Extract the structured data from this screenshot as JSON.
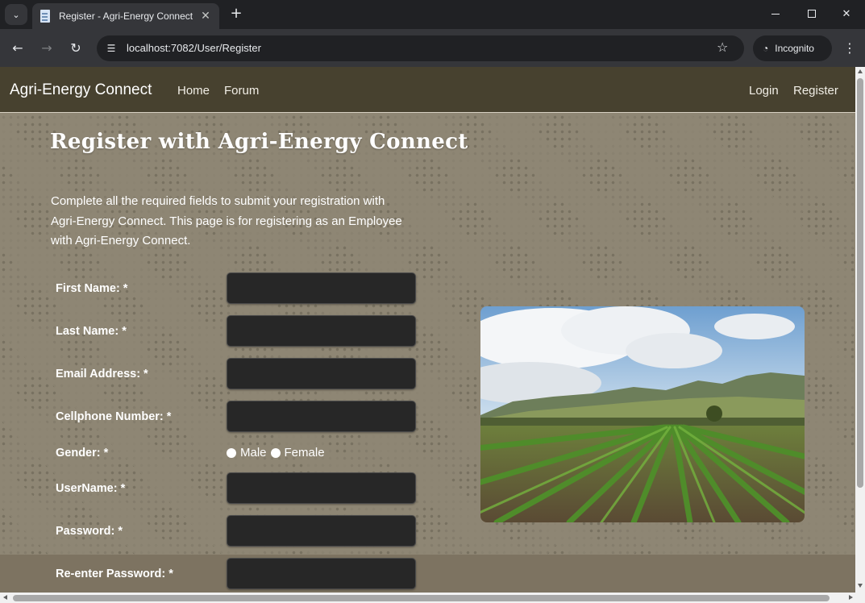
{
  "browser": {
    "tab_title": "Register - Agri-Energy Connect",
    "url": "localhost:7082/User/Register",
    "incognito_label": "Incognito",
    "icons": [
      "tab-search-icon",
      "favicon-icon",
      "close-icon",
      "plus-icon",
      "minimize-icon",
      "maximize-icon",
      "close-window-icon",
      "back-arrow-icon",
      "forward-arrow-icon",
      "reload-icon",
      "site-info-icon",
      "star-icon",
      "incognito-icon",
      "kebab-menu-icon"
    ]
  },
  "navbar": {
    "brand": "Agri-Energy Connect",
    "links": {
      "home": "Home",
      "forum": "Forum",
      "login": "Login",
      "register": "Register"
    },
    "background": "#47412f"
  },
  "page": {
    "title": "Register with Agri-Energy Connect",
    "intro": "Complete all the required fields to submit your registration with Agri-Energy Connect. This page is for registering as an Employee with Agri-Energy Connect.",
    "background": "#8e8674"
  },
  "form": {
    "first_name_label": "First Name: *",
    "last_name_label": "Last Name: *",
    "email_label": "Email Address: *",
    "cellphone_label": "Cellphone Number: *",
    "gender_label": "Gender: *",
    "gender_options": {
      "male": "Male",
      "female": "Female"
    },
    "username_label": "UserName: *",
    "password_label": "Password: *",
    "reenter_password_label": "Re-enter Password: *",
    "values": {
      "first_name": "",
      "last_name": "",
      "email": "",
      "cellphone": "",
      "username": "",
      "password": "",
      "reenter_password": ""
    }
  }
}
